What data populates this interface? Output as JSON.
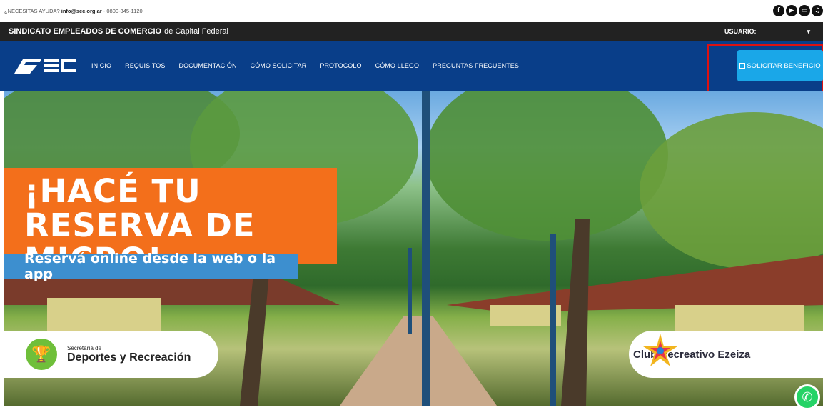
{
  "topbar": {
    "help_prefix": "¿NECESITAS AYUDA?",
    "email": "info@sec.org.ar",
    "phone_sep": " - 0800-345-1120",
    "social": [
      "facebook-icon",
      "youtube-icon",
      "chat-icon",
      "music-icon"
    ]
  },
  "union": {
    "name_bold": "SINDICATO EMPLEADOS DE COMERCIO",
    "name_rest": "de Capital Federal",
    "user_label": "USUARIO:",
    "user_caret": "▾"
  },
  "nav": {
    "items": [
      "INICIO",
      "REQUISITOS",
      "DOCUMENTACIÓN",
      "CÓMO SOLICITAR",
      "PROTOCOLO",
      "CÓMO LLEGO",
      "PREGUNTAS FRECUENTES"
    ],
    "cta": "SOLICITAR BENEFICIO"
  },
  "hero": {
    "title": "¡HACÉ TU RESERVA DE MICRO!",
    "subtitle": "Reservá online desde la web o la app",
    "left_badge_small": "Secretaría de",
    "left_badge_big": "Deportes y Recreación",
    "right_badge": "Club Recreativo Ezeiza"
  },
  "colors": {
    "nav_bg": "#093e89",
    "cta": "#1aa7e8",
    "promo": "#f36f1b",
    "promo_sub": "#3d8fcf"
  }
}
